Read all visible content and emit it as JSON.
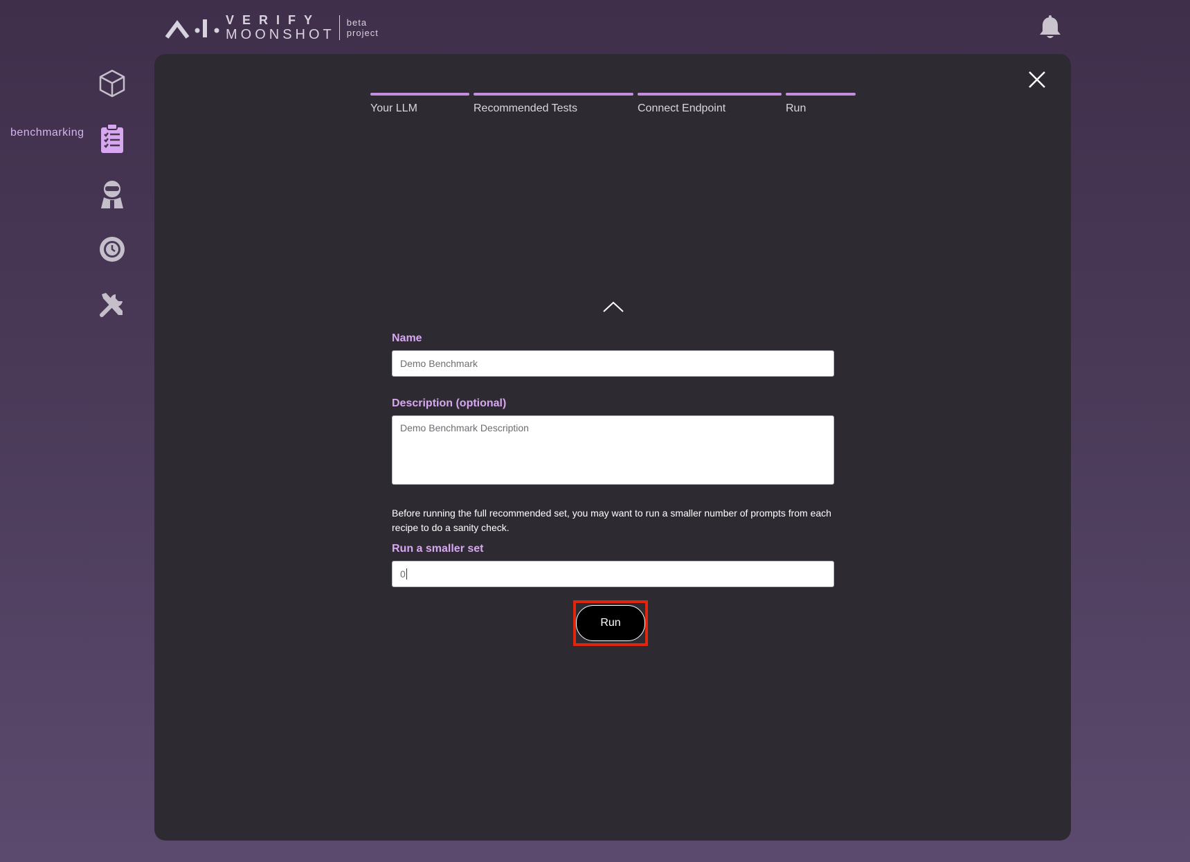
{
  "header": {
    "brand_line1": "VERIFY",
    "brand_line2": "MOONSHOT",
    "brand_tag1": "beta",
    "brand_tag2": "project"
  },
  "sidebar": {
    "active_label": "benchmarking",
    "items": [
      {
        "icon": "cube-icon"
      },
      {
        "icon": "clipboard-checklist-icon",
        "active": true
      },
      {
        "icon": "red-team-agent-icon"
      },
      {
        "icon": "history-clock-icon"
      },
      {
        "icon": "tools-icon"
      }
    ]
  },
  "stepper": {
    "steps": [
      {
        "label": "Your LLM"
      },
      {
        "label": "Recommended Tests"
      },
      {
        "label": "Connect Endpoint"
      },
      {
        "label": "Run"
      }
    ]
  },
  "form": {
    "name_label": "Name",
    "name_value": "Demo Benchmark",
    "description_label": "Description (optional)",
    "description_value": "Demo Benchmark Description",
    "note": "Before running the full recommended set, you may want to run a smaller number of prompts from each recipe to do a sanity check.",
    "smaller_set_label": "Run a smaller set",
    "smaller_set_value": "0",
    "run_label": "Run"
  },
  "colors": {
    "accent": "#c38ee0",
    "label": "#d7a8f0",
    "panel": "#2d2a32",
    "highlight": "#e0260f"
  }
}
